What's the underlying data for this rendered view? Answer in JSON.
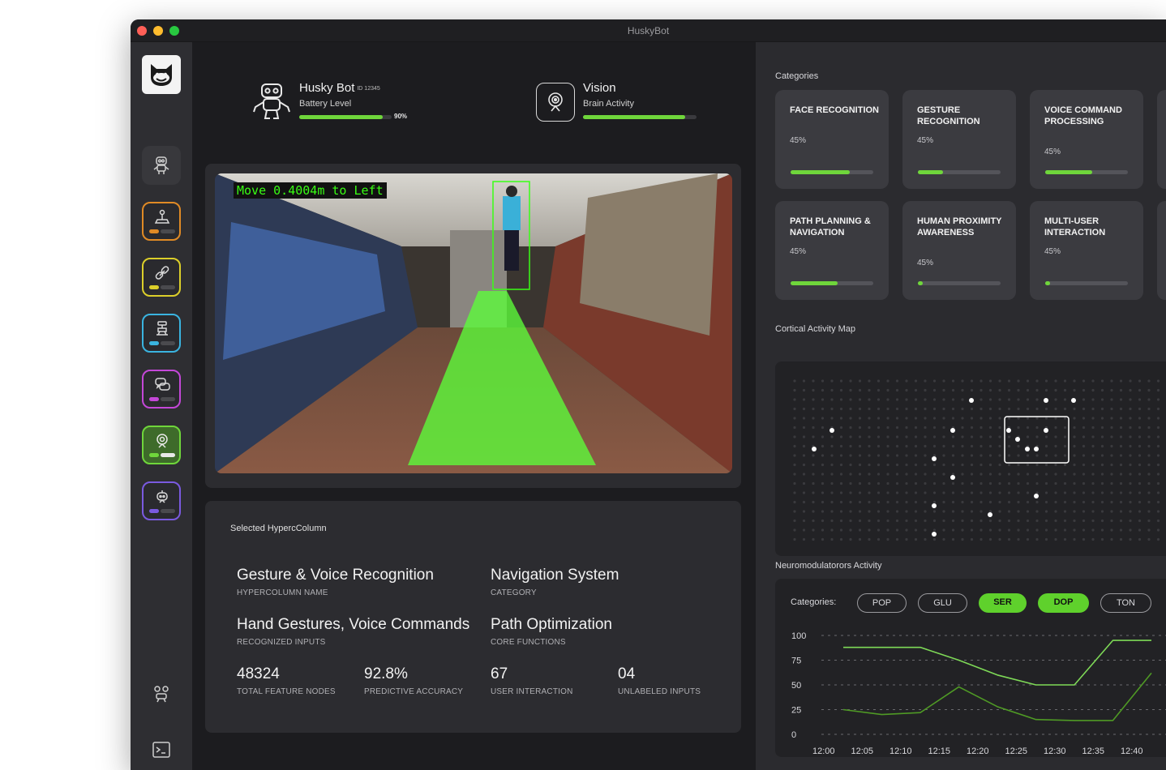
{
  "window": {
    "title": "HuskyBot"
  },
  "robot": {
    "name": "Husky Bot",
    "id": "ID 12345",
    "sub": "Battery Level",
    "battery_percent": 90,
    "battery_label": "90%"
  },
  "vision": {
    "name": "Vision",
    "sub": "Brain Activity",
    "activity_percent": 90
  },
  "video": {
    "overlay": "Move 0.4004m to Left"
  },
  "selected": {
    "title": "Selected HypercColumn",
    "name": "Gesture & Voice Recognition",
    "name_label": "HYPERCOLUMN NAME",
    "category": "Navigation System",
    "category_label": "CATEGORY",
    "inputs": "Hand Gestures, Voice Commands",
    "inputs_label": "RECOGNIZED INPUTS",
    "functions": "Path Optimization",
    "functions_label": "CORE FUNCTIONS",
    "nodes": "48324",
    "nodes_label": "TOTAL FEATURE NODES",
    "accuracy": "92.8%",
    "accuracy_label": "PREDICTIVE ACCURACY",
    "interaction": "67",
    "interaction_label": "USER INTERACTION",
    "unlabeled": "04",
    "unlabeled_label": "UNLABELED INPUTS"
  },
  "categories": {
    "title": "Categories",
    "items": [
      {
        "name": "FACE RECOGNITION",
        "pct": "45%",
        "fill": 0.72
      },
      {
        "name": "GESTURE RECOGNITION",
        "pct": "45%",
        "fill": 0.3
      },
      {
        "name": "VOICE COMMAND PROCESSING",
        "pct": "45%",
        "fill": 0.57
      },
      {
        "name": "PATH PLANNING & NAVIGATION",
        "pct": "45%",
        "fill": 0.57
      },
      {
        "name": "HUMAN PROXIMITY AWARENESS",
        "pct": "45%",
        "fill": 0.05
      },
      {
        "name": "MULTI-USER INTERACTION",
        "pct": "45%",
        "fill": 0.05
      }
    ]
  },
  "cortical": {
    "title": "Cortical Activity Map"
  },
  "neuro": {
    "title": "Neuromodulatorors Activity",
    "filter_label": "Categories:",
    "chips": [
      {
        "label": "POP",
        "active": false
      },
      {
        "label": "GLU",
        "active": false
      },
      {
        "label": "SER",
        "active": true
      },
      {
        "label": "DOP",
        "active": true
      },
      {
        "label": "TON",
        "active": false
      }
    ],
    "colors": {
      "active": "#5fd12c",
      "line_a": "#7ed957",
      "line_b": "#4f9a25"
    }
  },
  "chart_data": {
    "type": "line",
    "x": [
      "12:00",
      "12:05",
      "12:10",
      "12:15",
      "12:20",
      "12:25",
      "12:30",
      "12:35",
      "12:40"
    ],
    "ylim": [
      0,
      100
    ],
    "yticks": [
      0,
      25,
      50,
      75,
      100
    ],
    "series": [
      {
        "name": "SER",
        "values": [
          88,
          88,
          88,
          75,
          60,
          50,
          50,
          95,
          95
        ]
      },
      {
        "name": "DOP",
        "values": [
          25,
          20,
          22,
          48,
          28,
          15,
          14,
          14,
          62
        ]
      }
    ]
  }
}
